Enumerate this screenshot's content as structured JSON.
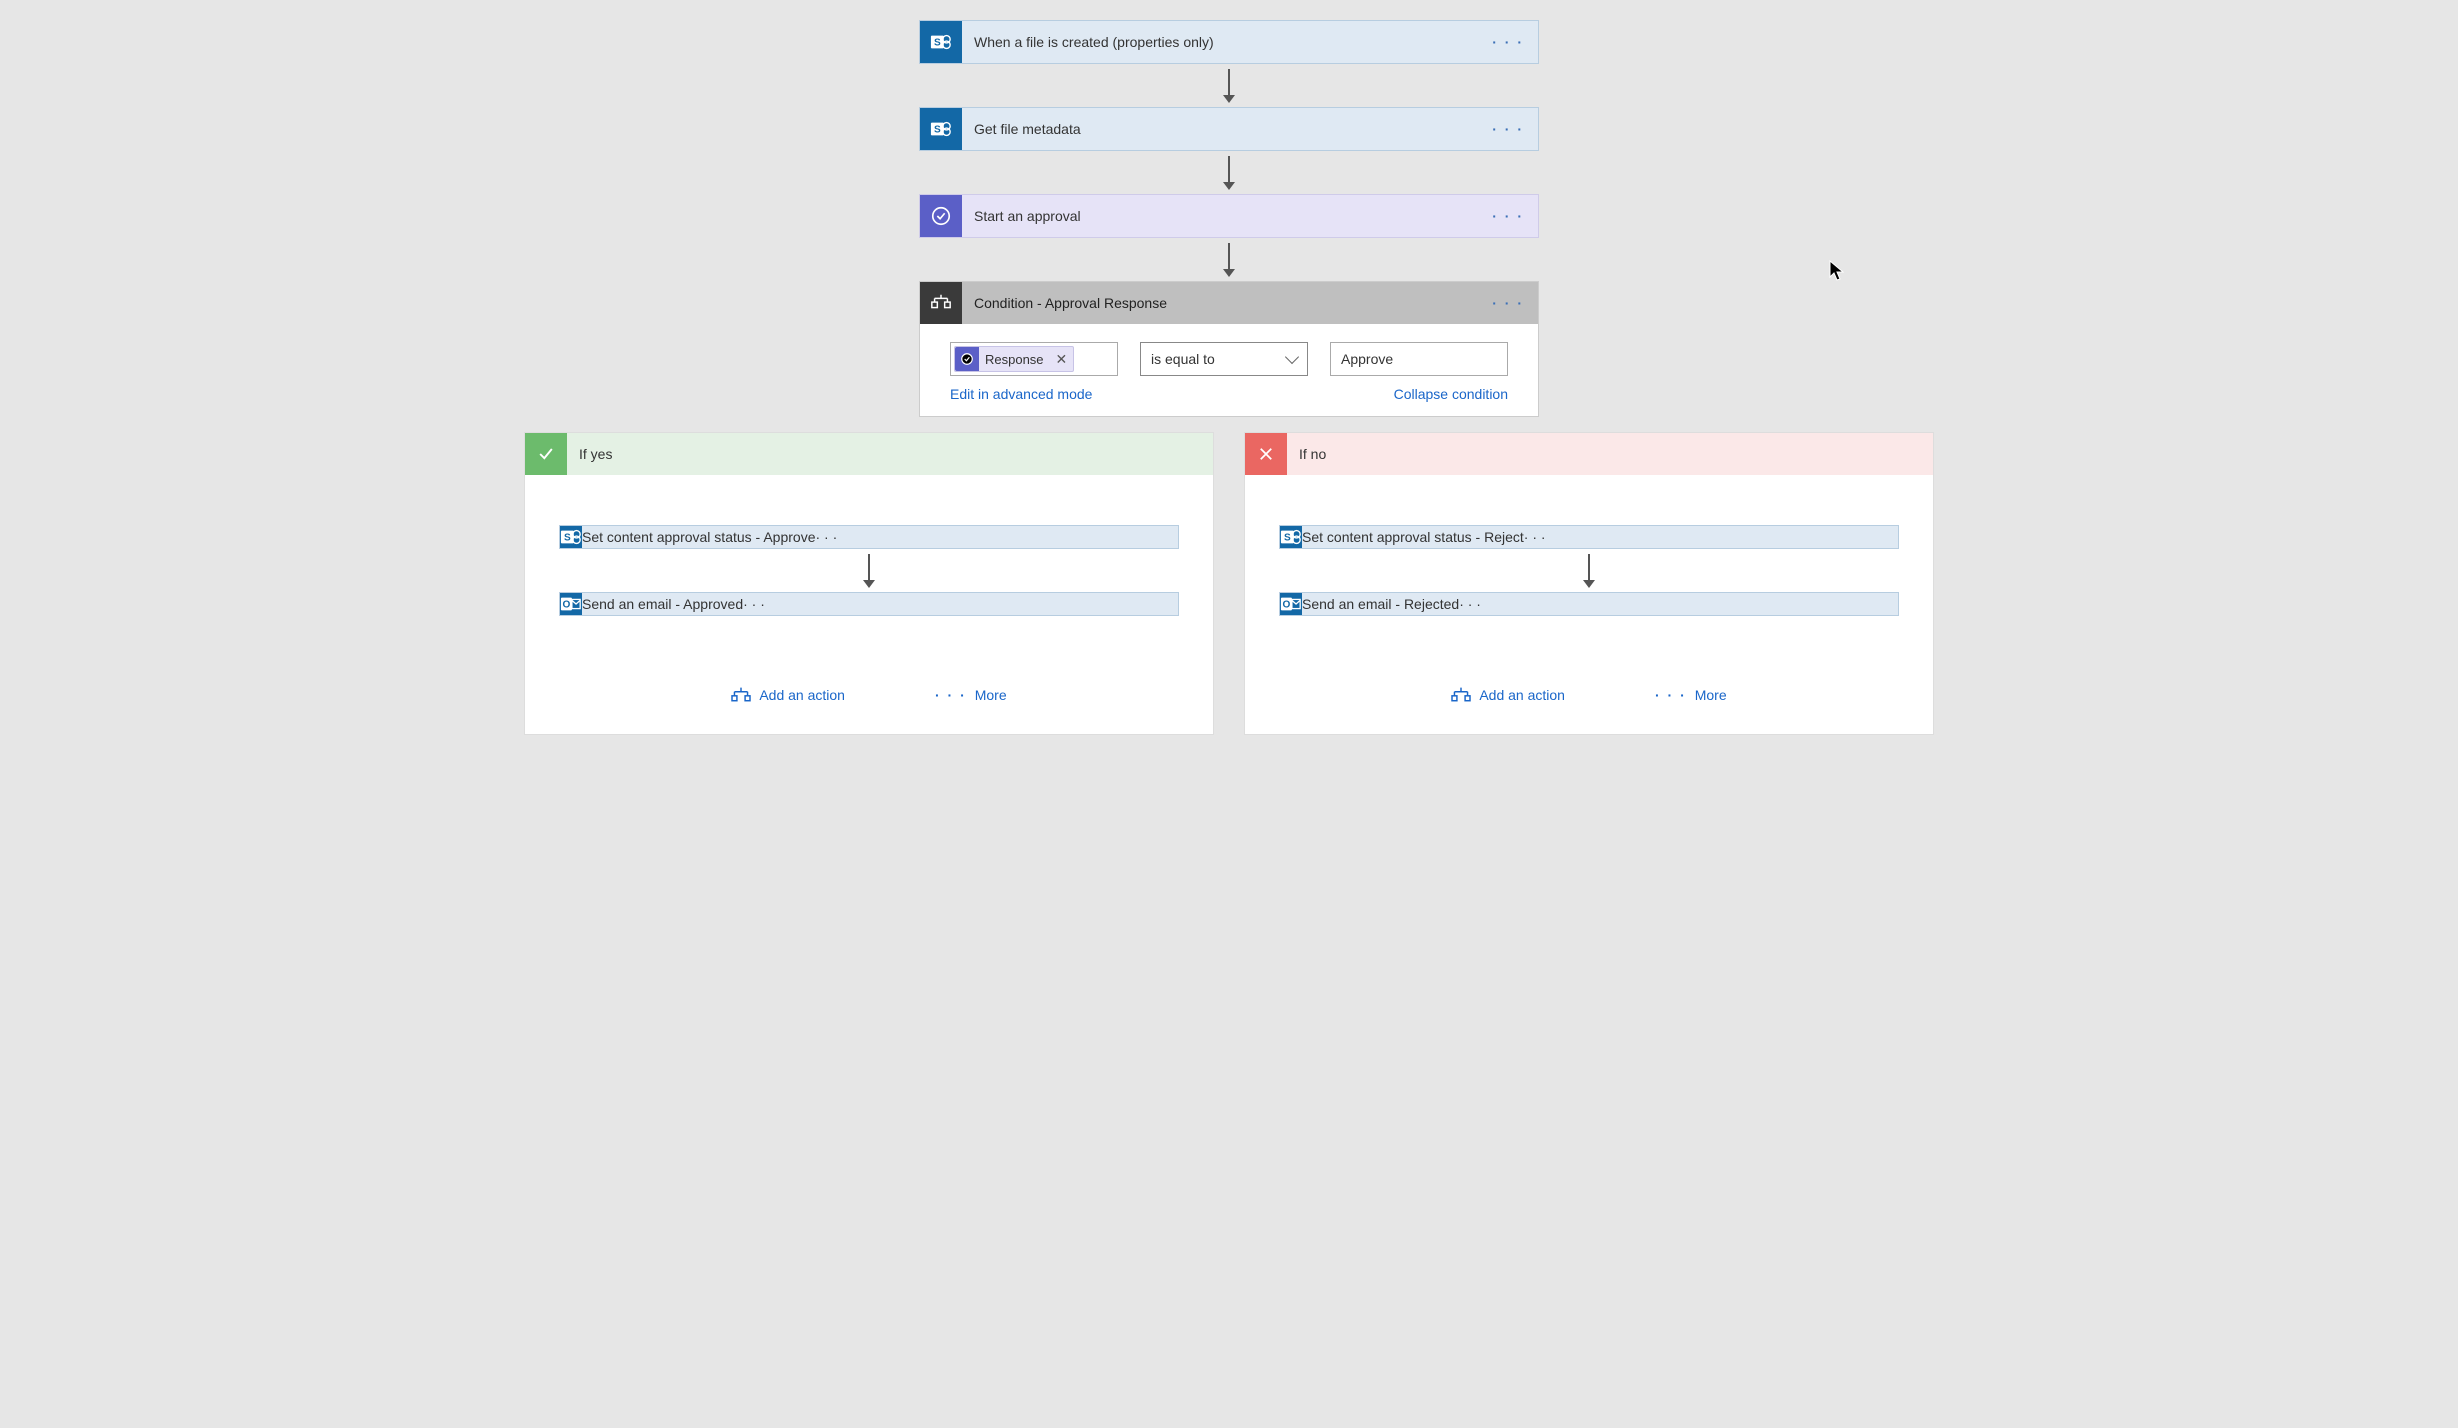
{
  "steps": {
    "trigger": "When a file is created (properties only)",
    "get_metadata": "Get file metadata",
    "start_approval": "Start an approval"
  },
  "condition": {
    "title": "Condition - Approval Response",
    "token_label": "Response",
    "operator": "is equal to",
    "value": "Approve",
    "edit_link": "Edit in advanced mode",
    "collapse_link": "Collapse condition"
  },
  "branches": {
    "yes": {
      "title": "If yes",
      "steps": {
        "set_status": "Set content approval status - Approve",
        "send_email": "Send an email - Approved"
      }
    },
    "no": {
      "title": "If no",
      "steps": {
        "set_status": "Set content approval status - Reject",
        "send_email": "Send an email - Rejected"
      }
    }
  },
  "actions": {
    "add_action": "Add an action",
    "more": "More"
  }
}
